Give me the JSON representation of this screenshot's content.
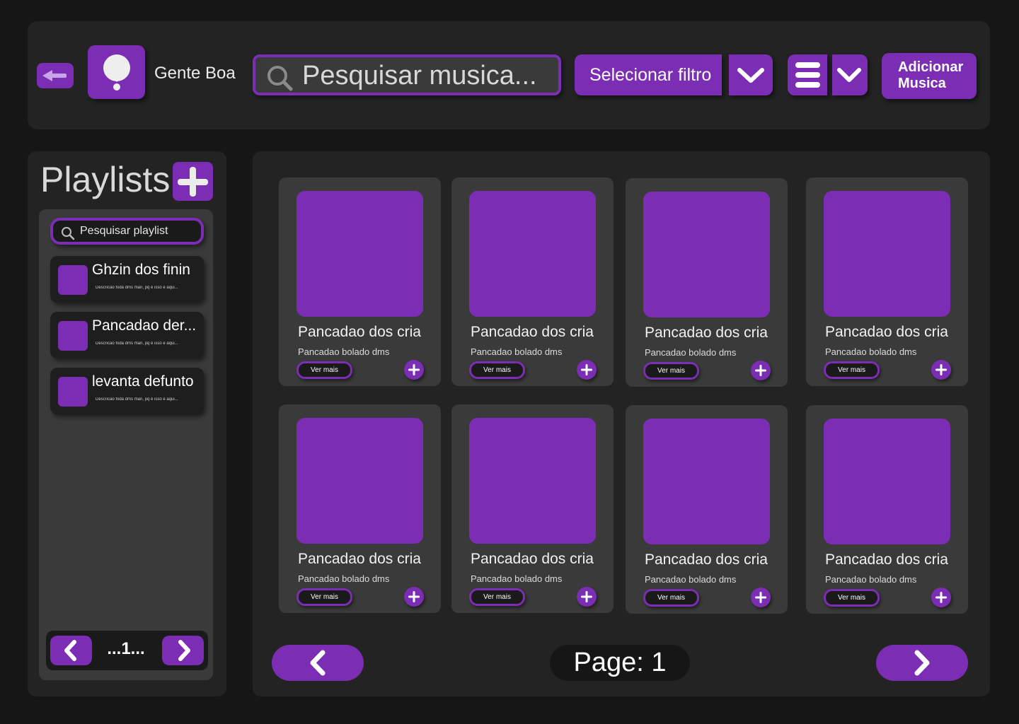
{
  "header": {
    "app_name": "Gente Boa",
    "search": {
      "placeholder": "Pesquisar musica..."
    },
    "filter_label": "Selecionar filtro",
    "add_music_line1": "Adicionar",
    "add_music_line2": "Musica",
    "icons": {
      "back": "arrow-left-icon",
      "logo": "lightbulb-icon",
      "search": "search-icon",
      "filter_dropdown": "chevron-down-icon",
      "menu": "hamburger-menu-icon",
      "menu_dropdown": "chevron-down-icon"
    }
  },
  "sidebar": {
    "title": "Playlists",
    "search": {
      "placeholder": "Pesquisar playlist"
    },
    "items": [
      {
        "name": "Ghzin dos finin",
        "description": "Descricao foda dms man, pq é isso e aqui..."
      },
      {
        "name": "Pancadao der...",
        "description": "Descricao foda dms man, pq é isso e aqui..."
      },
      {
        "name": "levanta defunto",
        "description": "Descricao foda dms man, pq é isso e aqui..."
      }
    ],
    "pager": {
      "label": "...1..."
    }
  },
  "main": {
    "cards": [
      {
        "title": "Pancadao dos cria",
        "subtitle": "Pancadao bolado dms",
        "more_label": "Ver mais"
      },
      {
        "title": "Pancadao dos cria",
        "subtitle": "Pancadao bolado dms",
        "more_label": "Ver mais"
      },
      {
        "title": "Pancadao dos cria",
        "subtitle": "Pancadao bolado dms",
        "more_label": "Ver mais"
      },
      {
        "title": "Pancadao dos cria",
        "subtitle": "Pancadao bolado dms",
        "more_label": "Ver mais"
      },
      {
        "title": "Pancadao dos cria",
        "subtitle": "Pancadao bolado dms",
        "more_label": "Ver mais"
      },
      {
        "title": "Pancadao dos cria",
        "subtitle": "Pancadao bolado dms",
        "more_label": "Ver mais"
      },
      {
        "title": "Pancadao dos cria",
        "subtitle": "Pancadao bolado dms",
        "more_label": "Ver mais"
      },
      {
        "title": "Pancadao dos cria",
        "subtitle": "Pancadao bolado dms",
        "more_label": "Ver mais"
      }
    ],
    "page_label": "Page: 1"
  },
  "colors": {
    "accent": "#7b2db3",
    "background": "#161616",
    "panel": "#232323",
    "card": "#3a3a3a"
  }
}
